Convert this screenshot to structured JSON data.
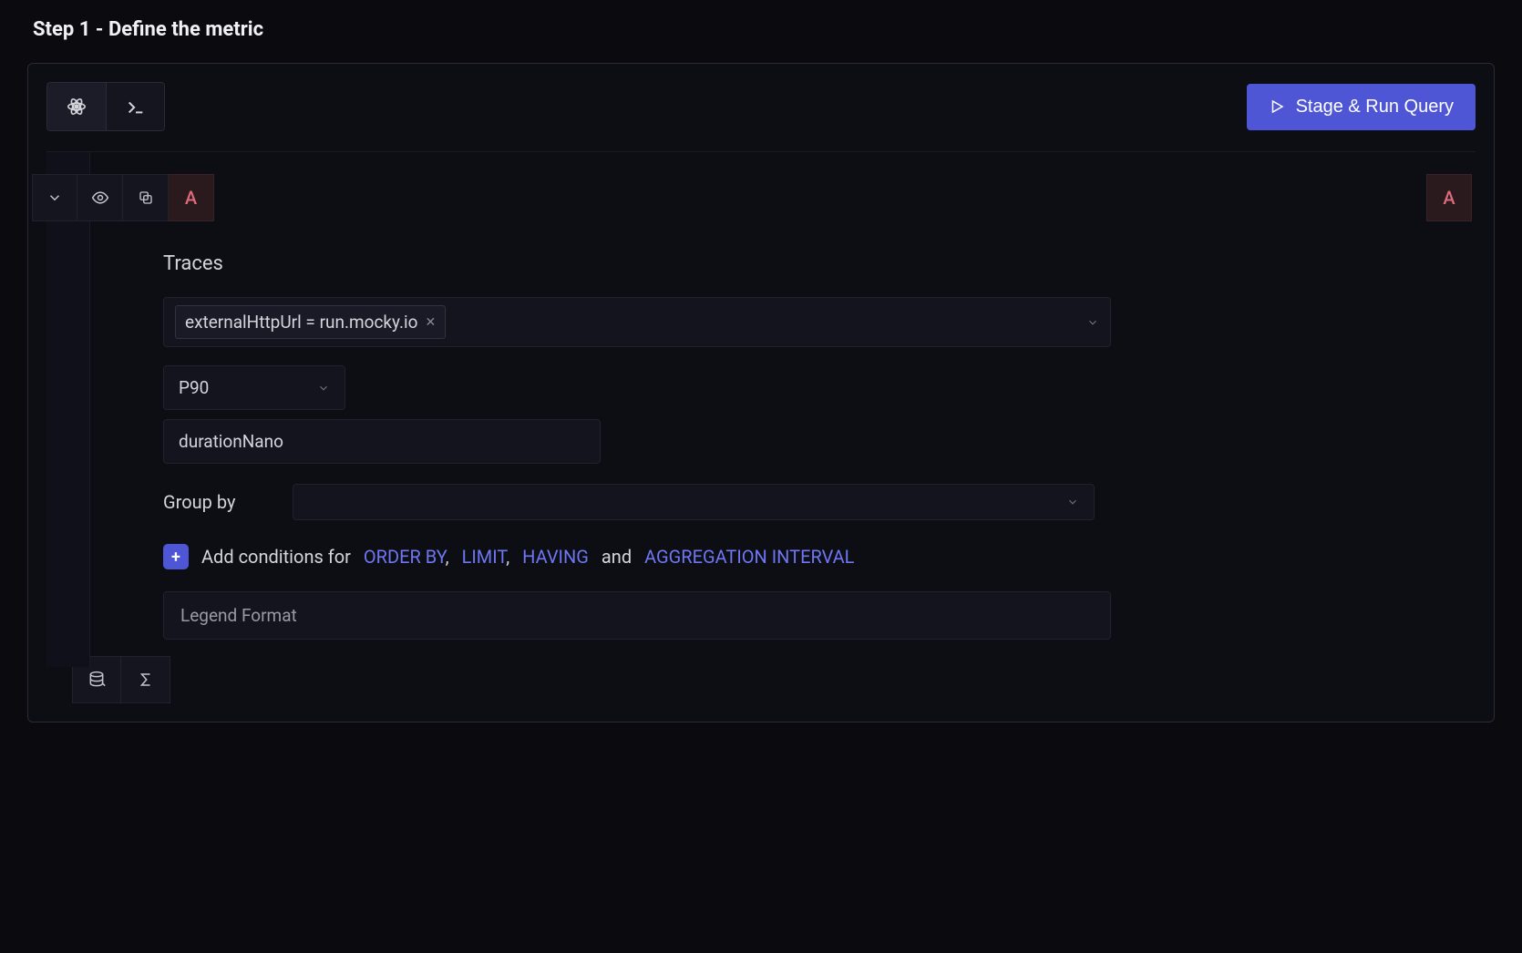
{
  "page": {
    "title": "Step 1 - Define the metric"
  },
  "toolbar": {
    "run_label": "Stage & Run Query"
  },
  "query": {
    "label_left": "A",
    "label_right": "A",
    "section_title": "Traces",
    "filter_chip": "externalHttpUrl = run.mocky.io",
    "aggregation": "P90",
    "metric_field": "durationNano",
    "group_by_label": "Group by",
    "group_by_value": "",
    "conditions": {
      "prefix": "Add conditions for",
      "order_by": "ORDER BY",
      "sep_comma": ",",
      "limit": "LIMIT",
      "having": "HAVING",
      "and": "and",
      "agg_interval": "AGGREGATION INTERVAL"
    },
    "legend_placeholder": "Legend Format"
  },
  "icons": {
    "builder": "atom-icon",
    "code": "terminal-icon",
    "play": "play-icon",
    "collapse": "chevron-down-icon",
    "visibility": "eye-icon",
    "copy": "copy-icon",
    "db": "database-icon",
    "sigma": "sigma-icon",
    "caret": "chevron-down-icon",
    "close": "close-icon"
  }
}
